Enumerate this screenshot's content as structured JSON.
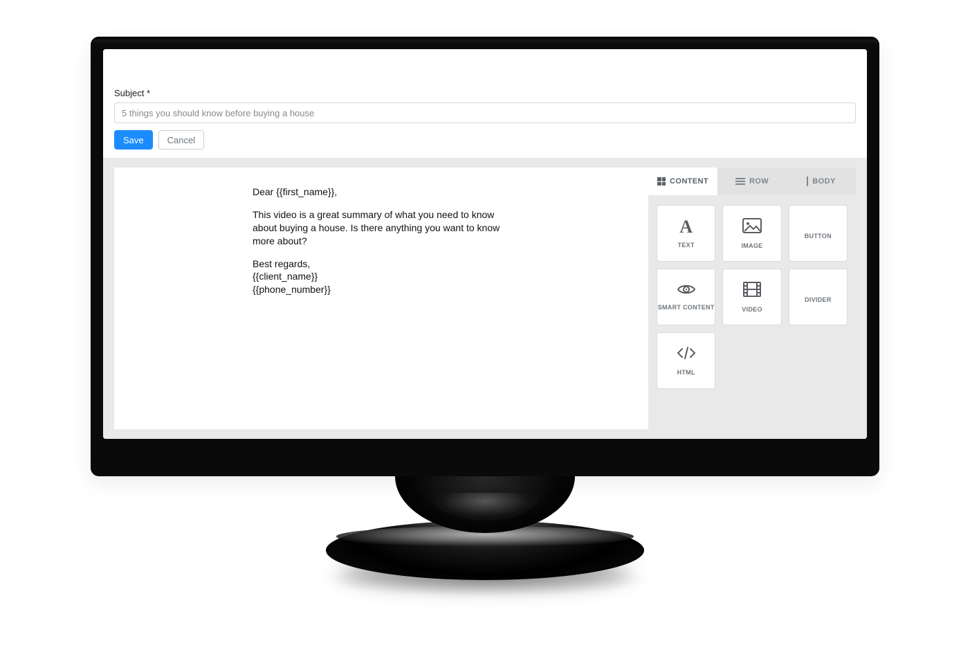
{
  "form": {
    "subject_label": "Subject *",
    "subject_value": "5 things you should know before buying a house",
    "save_label": "Save",
    "cancel_label": "Cancel"
  },
  "email": {
    "greeting": "Dear {{first_name}},",
    "body": "This video is a great summary of what you need to know about buying a house. Is there anything you want to know more about?",
    "closing": "Best regards,",
    "sig_line1": "{{client_name}}",
    "sig_line2": "{{phone_number}}"
  },
  "panel": {
    "tabs": {
      "content": "CONTENT",
      "row": "ROW",
      "body": "BODY"
    },
    "blocks": {
      "text": "TEXT",
      "image": "IMAGE",
      "button": "BUTTON",
      "smart_content": "SMART CONTENT",
      "video": "VIDEO",
      "divider": "DIVIDER",
      "html": "HTML"
    }
  }
}
